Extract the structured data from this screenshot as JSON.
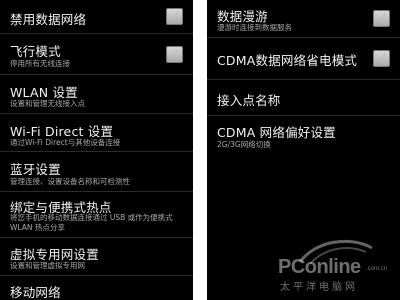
{
  "left_screen": {
    "items": [
      {
        "title": "禁用数据网络",
        "subtitle": "",
        "checkbox": true
      },
      {
        "title": "飞行模式",
        "subtitle": "停用所有无线连接",
        "checkbox": true
      },
      {
        "title": "WLAN 设置",
        "subtitle": "设置和管理无线接入点",
        "checkbox": false
      },
      {
        "title": "Wi-Fi Direct 设置",
        "subtitle": "通过Wi-Fi Direct与其他设备连接",
        "checkbox": false
      },
      {
        "title": "蓝牙设置",
        "subtitle": "管理连接、设置设备名称和可检测性",
        "checkbox": false
      },
      {
        "title": "绑定与便携式热点",
        "subtitle": "将您手机的移动数据连接通过 USB 或作为便携式 WLAN 热点分享",
        "checkbox": false
      },
      {
        "title": "虚拟专用网设置",
        "subtitle": "设置和管理虚拟专用网",
        "checkbox": false
      },
      {
        "title": "移动网络",
        "subtitle": "",
        "checkbox": false
      }
    ]
  },
  "right_screen": {
    "items": [
      {
        "title": "数据漫游",
        "subtitle": "漫游时连接到数据服务",
        "checkbox": true
      },
      {
        "title": "CDMA数据网络省电模式",
        "subtitle": "",
        "checkbox": true
      },
      {
        "title": "接入点名称",
        "subtitle": "",
        "checkbox": false
      },
      {
        "title": "CDMA 网络偏好设置",
        "subtitle": "2G/3G网络切换",
        "checkbox": false
      }
    ]
  },
  "watermark": {
    "brand": "PConline",
    "brand_suffix": ".com.cn",
    "tagline": "太平洋电脑网"
  }
}
